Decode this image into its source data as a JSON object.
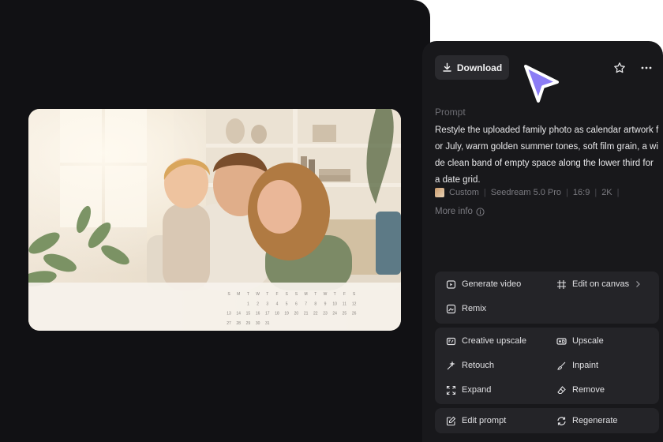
{
  "toolbar": {
    "download_label": "Download",
    "download_icon": "download-icon",
    "favorite_icon": "star-icon",
    "more_icon": "more-icon"
  },
  "prompt": {
    "label": "Prompt",
    "text": "Restyle the uploaded family photo as calendar artwork for July, warm golden summer tones, soft film grain, a wide clean band of empty space along the lower third for a date grid."
  },
  "meta": {
    "style": "Custom",
    "model": "Seedream 5.0 Pro",
    "ratio": "16:9",
    "resolution": "2K",
    "more_info": "More info"
  },
  "actions": {
    "generate_video": "Generate video",
    "edit_on_canvas": "Edit on canvas",
    "remix": "Remix",
    "creative_upscale": "Creative upscale",
    "upscale": "Upscale",
    "retouch": "Retouch",
    "inpaint": "Inpaint",
    "expand": "Expand",
    "remove": "Remove",
    "edit_prompt": "Edit prompt",
    "regenerate": "Regenerate"
  },
  "calendar": {
    "days": [
      "S",
      "M",
      "T",
      "W",
      "T",
      "F",
      "S",
      "S",
      "M",
      "T",
      "W",
      "T",
      "F",
      "S"
    ],
    "rows": [
      [
        "",
        "",
        "1",
        "2",
        "3",
        "4",
        "5",
        "6",
        "7",
        "8",
        "9",
        "10",
        "11",
        "12"
      ],
      [
        "13",
        "14",
        "15",
        "16",
        "17",
        "18",
        "19",
        "20",
        "21",
        "22",
        "23",
        "24",
        "25",
        "26"
      ],
      [
        "27",
        "28",
        "29",
        "30",
        "31",
        "",
        "",
        "",
        "",
        "",
        "",
        "",
        "",
        ""
      ]
    ]
  },
  "colors": {
    "canvas_bg": "#111114",
    "panel_bg": "#18181b",
    "group_bg": "#242428",
    "cursor": "#8b7cf6"
  }
}
